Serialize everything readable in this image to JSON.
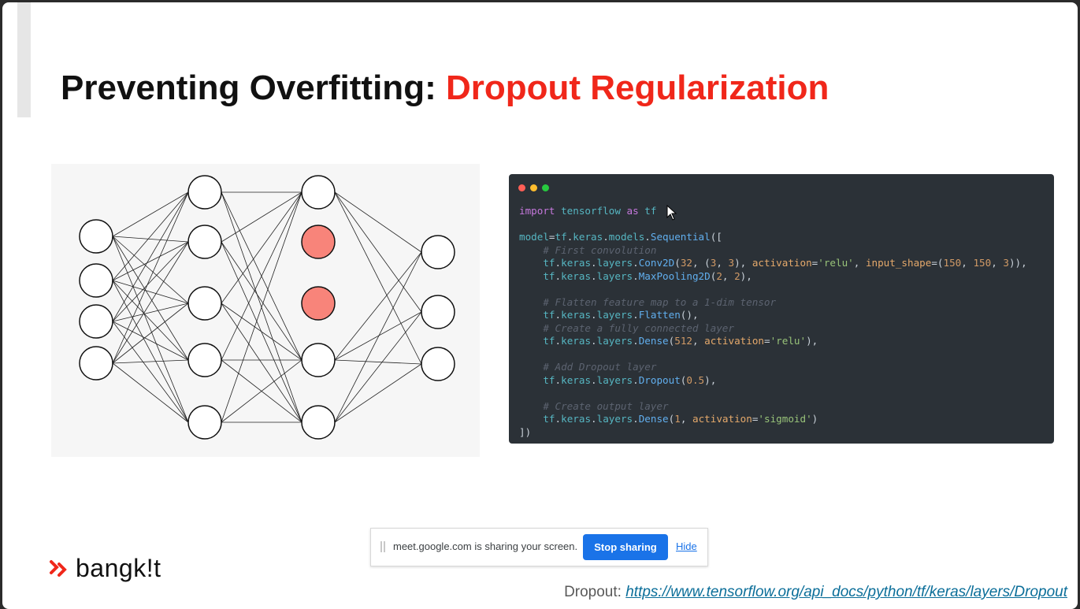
{
  "slide": {
    "title_prefix": "Preventing Overfitting: ",
    "title_highlight": "Dropout Regularization"
  },
  "colors": {
    "accent": "#f0271a",
    "dropped_neuron": "#f8847a",
    "code_background": "#2b3137",
    "link": "#0b6e99"
  },
  "diagram": {
    "layers": [
      4,
      5,
      5,
      3
    ],
    "dropped_neurons": [
      {
        "layer": 2,
        "index": 1
      },
      {
        "layer": 2,
        "index": 2
      }
    ]
  },
  "code_window": {
    "lines": [
      [
        [
          "kw",
          "import"
        ],
        [
          "pl",
          " "
        ],
        [
          "id",
          "tensorflow"
        ],
        [
          "pl",
          " "
        ],
        [
          "kw",
          "as"
        ],
        [
          "pl",
          " "
        ],
        [
          "id",
          "tf"
        ]
      ],
      [],
      [
        [
          "id",
          "model"
        ],
        [
          "pl",
          "="
        ],
        [
          "id",
          "tf"
        ],
        [
          "pl",
          "."
        ],
        [
          "id",
          "keras"
        ],
        [
          "pl",
          "."
        ],
        [
          "id",
          "models"
        ],
        [
          "pl",
          "."
        ],
        [
          "fn",
          "Sequential"
        ],
        [
          "pl",
          "(["
        ]
      ],
      [
        [
          "pl",
          "    "
        ],
        [
          "cm",
          "# First convolution"
        ]
      ],
      [
        [
          "pl",
          "    "
        ],
        [
          "id",
          "tf"
        ],
        [
          "pl",
          "."
        ],
        [
          "id",
          "keras"
        ],
        [
          "pl",
          "."
        ],
        [
          "id",
          "layers"
        ],
        [
          "pl",
          "."
        ],
        [
          "fn",
          "Conv2D"
        ],
        [
          "pl",
          "("
        ],
        [
          "num",
          "32"
        ],
        [
          "pl",
          ", ("
        ],
        [
          "num",
          "3"
        ],
        [
          "pl",
          ", "
        ],
        [
          "num",
          "3"
        ],
        [
          "pl",
          "), "
        ],
        [
          "param",
          "activation"
        ],
        [
          "pl",
          "="
        ],
        [
          "str",
          "'relu'"
        ],
        [
          "pl",
          ", "
        ],
        [
          "param",
          "input_shape"
        ],
        [
          "pl",
          "=("
        ],
        [
          "num",
          "150"
        ],
        [
          "pl",
          ", "
        ],
        [
          "num",
          "150"
        ],
        [
          "pl",
          ", "
        ],
        [
          "num",
          "3"
        ],
        [
          "pl",
          ")),"
        ]
      ],
      [
        [
          "pl",
          "    "
        ],
        [
          "id",
          "tf"
        ],
        [
          "pl",
          "."
        ],
        [
          "id",
          "keras"
        ],
        [
          "pl",
          "."
        ],
        [
          "id",
          "layers"
        ],
        [
          "pl",
          "."
        ],
        [
          "fn",
          "MaxPooling2D"
        ],
        [
          "pl",
          "("
        ],
        [
          "num",
          "2"
        ],
        [
          "pl",
          ", "
        ],
        [
          "num",
          "2"
        ],
        [
          "pl",
          "),"
        ]
      ],
      [],
      [
        [
          "pl",
          "    "
        ],
        [
          "cm",
          "# Flatten feature map to a 1-dim tensor"
        ]
      ],
      [
        [
          "pl",
          "    "
        ],
        [
          "id",
          "tf"
        ],
        [
          "pl",
          "."
        ],
        [
          "id",
          "keras"
        ],
        [
          "pl",
          "."
        ],
        [
          "id",
          "layers"
        ],
        [
          "pl",
          "."
        ],
        [
          "fn",
          "Flatten"
        ],
        [
          "pl",
          "(),"
        ]
      ],
      [
        [
          "pl",
          "    "
        ],
        [
          "cm",
          "# Create a fully connected layer"
        ]
      ],
      [
        [
          "pl",
          "    "
        ],
        [
          "id",
          "tf"
        ],
        [
          "pl",
          "."
        ],
        [
          "id",
          "keras"
        ],
        [
          "pl",
          "."
        ],
        [
          "id",
          "layers"
        ],
        [
          "pl",
          "."
        ],
        [
          "fn",
          "Dense"
        ],
        [
          "pl",
          "("
        ],
        [
          "num",
          "512"
        ],
        [
          "pl",
          ", "
        ],
        [
          "param",
          "activation"
        ],
        [
          "pl",
          "="
        ],
        [
          "str",
          "'relu'"
        ],
        [
          "pl",
          "),"
        ]
      ],
      [],
      [
        [
          "pl",
          "    "
        ],
        [
          "cm",
          "# Add Dropout layer"
        ]
      ],
      [
        [
          "pl",
          "    "
        ],
        [
          "id",
          "tf"
        ],
        [
          "pl",
          "."
        ],
        [
          "id",
          "keras"
        ],
        [
          "pl",
          "."
        ],
        [
          "id",
          "layers"
        ],
        [
          "pl",
          "."
        ],
        [
          "fn",
          "Dropout"
        ],
        [
          "pl",
          "("
        ],
        [
          "num",
          "0.5"
        ],
        [
          "pl",
          "),"
        ]
      ],
      [],
      [
        [
          "pl",
          "    "
        ],
        [
          "cm",
          "# Create output layer"
        ]
      ],
      [
        [
          "pl",
          "    "
        ],
        [
          "id",
          "tf"
        ],
        [
          "pl",
          "."
        ],
        [
          "id",
          "keras"
        ],
        [
          "pl",
          "."
        ],
        [
          "id",
          "layers"
        ],
        [
          "pl",
          "."
        ],
        [
          "fn",
          "Dense"
        ],
        [
          "pl",
          "("
        ],
        [
          "num",
          "1"
        ],
        [
          "pl",
          ", "
        ],
        [
          "param",
          "activation"
        ],
        [
          "pl",
          "="
        ],
        [
          "str",
          "'sigmoid'"
        ],
        [
          "pl",
          ")"
        ]
      ],
      [
        [
          "pl",
          "])"
        ]
      ]
    ]
  },
  "share_bar": {
    "message": "meet.google.com is sharing your screen.",
    "stop_label": "Stop sharing",
    "hide_label": "Hide"
  },
  "logo": {
    "text": "bangk!t"
  },
  "footer": {
    "prefix": "Dropout: ",
    "link_text": "https://www.tensorflow.org/api_docs/python/tf/keras/layers/Dropout"
  }
}
